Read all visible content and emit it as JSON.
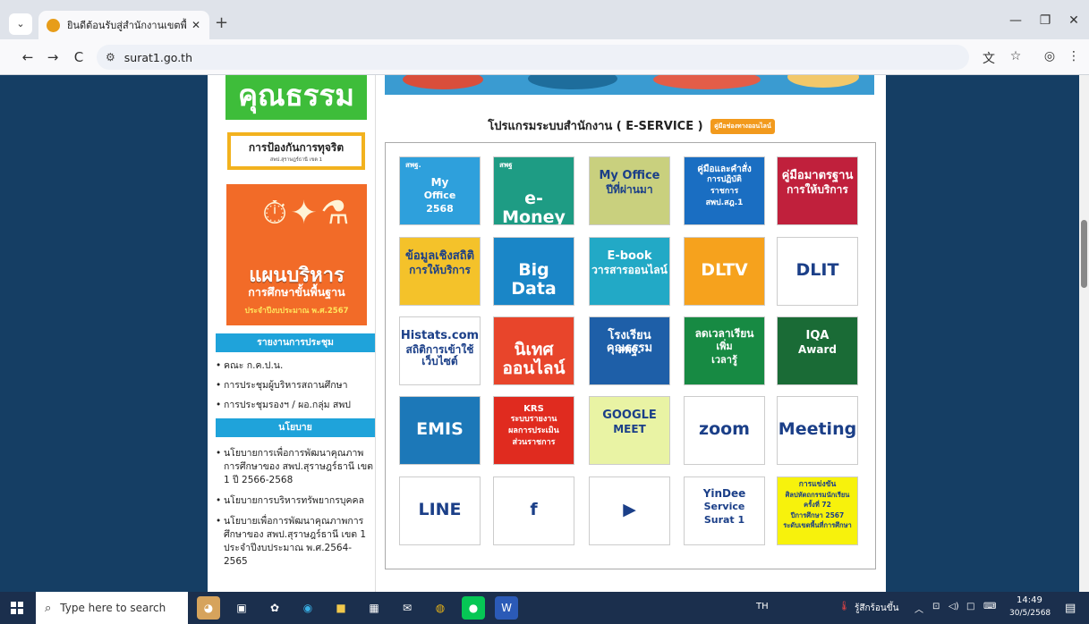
{
  "browser": {
    "tab_title": "ยินดีต้อนรับสู่สำนักงานเขตพื้นที่การศึ",
    "tab_close": "✕",
    "new_tab": "+",
    "url": "surat1.go.th",
    "back": "←",
    "forward": "→",
    "reload": "C",
    "translate_icon": "translate-icon",
    "star": "☆",
    "profile": "◎",
    "menu": "⋮",
    "window_min": "—",
    "window_restore": "❐",
    "window_close": "✕"
  },
  "sidebar": {
    "banner_text": "คุณธรรม",
    "anti_corruption": {
      "title": "การป้องกันการทุจริต",
      "subtitle": "สพป.สุราษฎร์ธานี เขต 1"
    },
    "plan": {
      "line1": "แผนบริหาร",
      "line2": "การศึกษาขั้นพื้นฐาน",
      "line3": "ประจำปีงบประมาณ พ.ศ.2567"
    },
    "meeting_header": "รายงานการประชุม",
    "meeting_items": [
      "คณะ ก.ค.ป.น.",
      "การประชุมผู้บริหารสถานศึกษา",
      "การประชุมรองฯ / ผอ.กลุ่ม สพป"
    ],
    "policy_header": "นโยบาย",
    "policy_items": [
      "นโยบายการเพื่อการพัฒนาคุณภาพการศึกษาของ สพป.สุราษฎร์ธานี เขต 1 ปี 2566-2568",
      "นโยบายการบริหารทรัพยากรบุคคล",
      "นโยบายเพื่อการพัฒนาคุณภาพการศึกษาของ สพป.สุราษฎร์ธานี เขต 1 ประจำปีงบประมาณ พ.ศ.2564-2565"
    ]
  },
  "main": {
    "eservice_title": "โปรแกรมระบบสำนักงาน ( E-SERVICE )",
    "manual_badge": "คู่มือช่องทางออนไลน์",
    "tiles": [
      {
        "row": 0,
        "col": 0,
        "bg": "#2ea0dc",
        "lines": [
          "My",
          "Office",
          "2568"
        ],
        "top": "สพฐ."
      },
      {
        "row": 0,
        "col": 1,
        "bg": "#1e9c84",
        "lines": [
          "e-Money"
        ],
        "top": "สพฐ"
      },
      {
        "row": 0,
        "col": 2,
        "bg": "#c9d07e",
        "lines": [
          "My Office",
          "ปีที่ผ่านมา"
        ]
      },
      {
        "row": 0,
        "col": 3,
        "bg": "#1a6ec2",
        "lines": [
          "คู่มือและคำสั่ง",
          "การปฏิบัติ",
          "ราชการ",
          "สพป.สฎ.1"
        ]
      },
      {
        "row": 0,
        "col": 4,
        "bg": "#c0203c",
        "lines": [
          "คู่มือมาตรฐาน",
          "การให้บริการ"
        ]
      },
      {
        "row": 1,
        "col": 0,
        "bg": "#f4c22a",
        "lines": [
          "ข้อมูลเชิงสถิติ",
          "การให้บริการ"
        ]
      },
      {
        "row": 1,
        "col": 1,
        "bg": "#1a86c7",
        "lines": [
          "Big Data"
        ]
      },
      {
        "row": 1,
        "col": 2,
        "bg": "#22a9c6",
        "lines": [
          "E-book",
          "วารสารออนไลน์"
        ]
      },
      {
        "row": 1,
        "col": 3,
        "bg": "#f6a21d",
        "lines": [
          "DLTV"
        ]
      },
      {
        "row": 1,
        "col": 4,
        "bg": "#ffffff",
        "lines": [
          "DLIT"
        ]
      },
      {
        "row": 2,
        "col": 0,
        "bg": "#ffffff",
        "lines": [
          "Histats.com",
          "สถิติการเข้าใช้เว็บไซต์"
        ]
      },
      {
        "row": 2,
        "col": 1,
        "bg": "#e8452b",
        "lines": [
          "นิเทศออนไลน์"
        ]
      },
      {
        "row": 2,
        "col": 2,
        "bg": "#1e5fa8",
        "lines": [
          "โรงเรียนคุณธรรม",
          "สพฐ."
        ]
      },
      {
        "row": 2,
        "col": 3,
        "bg": "#178a43",
        "lines": [
          "ลดเวลาเรียน",
          "เพิ่ม",
          "เวลารู้"
        ]
      },
      {
        "row": 2,
        "col": 4,
        "bg": "#1a6b36",
        "lines": [
          "IQA",
          "Award"
        ]
      },
      {
        "row": 3,
        "col": 0,
        "bg": "#1c78b8",
        "lines": [
          "EMIS"
        ]
      },
      {
        "row": 3,
        "col": 1,
        "bg": "#e02b1f",
        "lines": [
          "KRS",
          "ระบบรายงาน",
          "ผลการประเมิน",
          "ส่วนราชการ"
        ]
      },
      {
        "row": 3,
        "col": 2,
        "bg": "#e9f3a4",
        "lines": [
          "GOOGLE",
          "MEET"
        ]
      },
      {
        "row": 3,
        "col": 3,
        "bg": "#ffffff",
        "lines": [
          "zoom"
        ]
      },
      {
        "row": 3,
        "col": 4,
        "bg": "#ffffff",
        "lines": [
          "Meeting"
        ]
      },
      {
        "row": 4,
        "col": 0,
        "bg": "#ffffff",
        "lines": [
          "LINE"
        ]
      },
      {
        "row": 4,
        "col": 1,
        "bg": "#ffffff",
        "lines": [
          "f"
        ]
      },
      {
        "row": 4,
        "col": 2,
        "bg": "#ffffff",
        "lines": [
          "▶"
        ]
      },
      {
        "row": 4,
        "col": 3,
        "bg": "#ffffff",
        "lines": [
          "YinDee",
          "Service",
          "Surat 1"
        ]
      },
      {
        "row": 4,
        "col": 4,
        "bg": "#f7f20c",
        "lines": [
          "การแข่งขัน",
          "ศิลปหัตถกรรมนักเรียน",
          "ครั้งที่ 72",
          "ปีการศึกษา 2567",
          "ระดับเขตพื้นที่การศึกษา"
        ]
      }
    ]
  },
  "taskbar": {
    "search_placeholder": "Type here to search",
    "lang": "TH",
    "weather": "รู้สึกร้อนขึ้น",
    "time": "14:49",
    "date": "30/5/2568"
  }
}
